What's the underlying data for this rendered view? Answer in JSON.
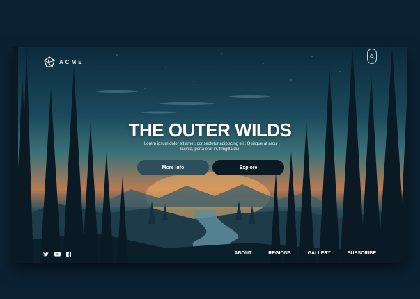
{
  "brand": {
    "name": "ACME",
    "logo_icon": "geometric-logo-icon"
  },
  "search": {
    "icon": "search-icon"
  },
  "hero": {
    "title": "THE OUTER WILDS",
    "text": "Lorem ipsum dolor sit amet, consectetur adipiscing elit. Quisque at arcu lacinia, porta erat in, fringilla dui.",
    "buttons": {
      "more_info": "More Info",
      "explore": "Explore"
    }
  },
  "social": [
    "twitter-icon",
    "youtube-icon",
    "facebook-icon"
  ],
  "nav": {
    "items": [
      "ABOUT",
      "REGIONS",
      "GALLERY",
      "SUBSCRIBE"
    ]
  },
  "colors": {
    "background": "#0c2233",
    "button_more_info": "#2d4e5a",
    "button_explore": "#0b1b26",
    "text": "#ffffff"
  }
}
